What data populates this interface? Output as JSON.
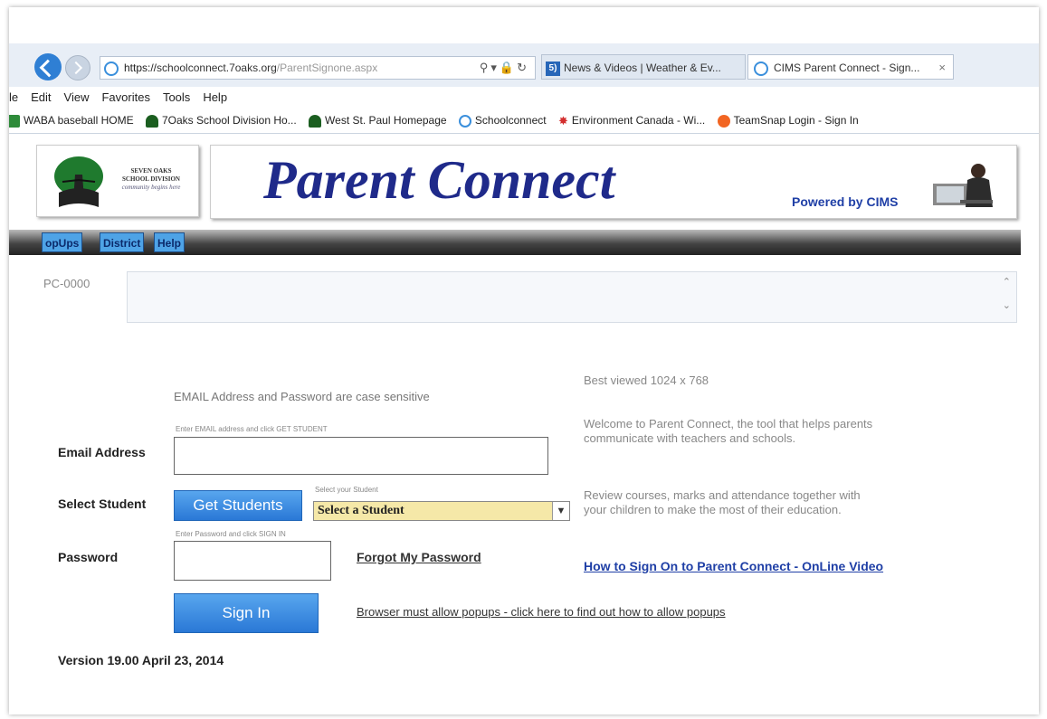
{
  "browser": {
    "address": {
      "prefix": "https://",
      "host": "schoolconnect.7oaks.org",
      "path": "/ParentSignone.aspx"
    },
    "tabs": [
      {
        "badge": "5)",
        "label": "News & Videos | Weather & Ev..."
      },
      {
        "label": "CIMS Parent Connect - Sign...",
        "close": "×"
      }
    ],
    "menu": [
      "le",
      "Edit",
      "View",
      "Favorites",
      "Tools",
      "Help"
    ],
    "favorites": [
      {
        "label": "WABA baseball HOME",
        "icon": "waba-icon",
        "color": "#2e8b3a"
      },
      {
        "label": "7Oaks School Division Ho...",
        "icon": "tree-icon",
        "color": "#1b5e20"
      },
      {
        "label": "West St. Paul Homepage",
        "icon": "tree-icon",
        "color": "#1b5e20"
      },
      {
        "label": "Schoolconnect",
        "icon": "ie-icon",
        "color": "#3a8fdc"
      },
      {
        "label": "Environment Canada - Wi...",
        "icon": "maple-leaf-icon",
        "color": "#d32f2f"
      },
      {
        "label": "TeamSnap Login - Sign In",
        "icon": "teamsnap-icon",
        "color": "#f26522"
      }
    ]
  },
  "header": {
    "school": {
      "line1": "SEVEN OAKS",
      "line2": "SCHOOL DIVISION",
      "tagline": "community begins here"
    },
    "title": "Parent Connect",
    "powered_by": "Powered by CIMS"
  },
  "nav": {
    "items": [
      "opUps",
      "District",
      "Help"
    ]
  },
  "message": {
    "code": "PC-0000"
  },
  "form": {
    "case_note": "EMAIL Address and Password are case sensitive",
    "email": {
      "hint": "Enter EMAIL address and click GET STUDENT",
      "label": "Email Address",
      "value": ""
    },
    "student": {
      "label": "Select Student",
      "button": "Get Students",
      "select_hint": "Select your Student",
      "selected": "Select a Student"
    },
    "password": {
      "hint": "Enter Password and click SIGN IN",
      "label": "Password",
      "value": "",
      "forgot": "Forgot My Password"
    },
    "sign_in": "Sign In",
    "popup_link": "Browser must allow popups - click here to find out how to allow popups",
    "version": "Version 19.00 April 23, 2014"
  },
  "info": {
    "best_viewed": "Best viewed 1024 x 768",
    "welcome": "Welcome to Parent Connect, the tool that helps parents communicate with teachers and schools.",
    "review": "Review courses, marks and attendance together with your children to make the most of their education.",
    "video_link": "How to Sign On to Parent Connect - OnLine Video"
  },
  "colors": {
    "brand_blue": "#1f2a8a",
    "button_blue": "#2a78d6",
    "select_bg": "#f5e8a8"
  }
}
